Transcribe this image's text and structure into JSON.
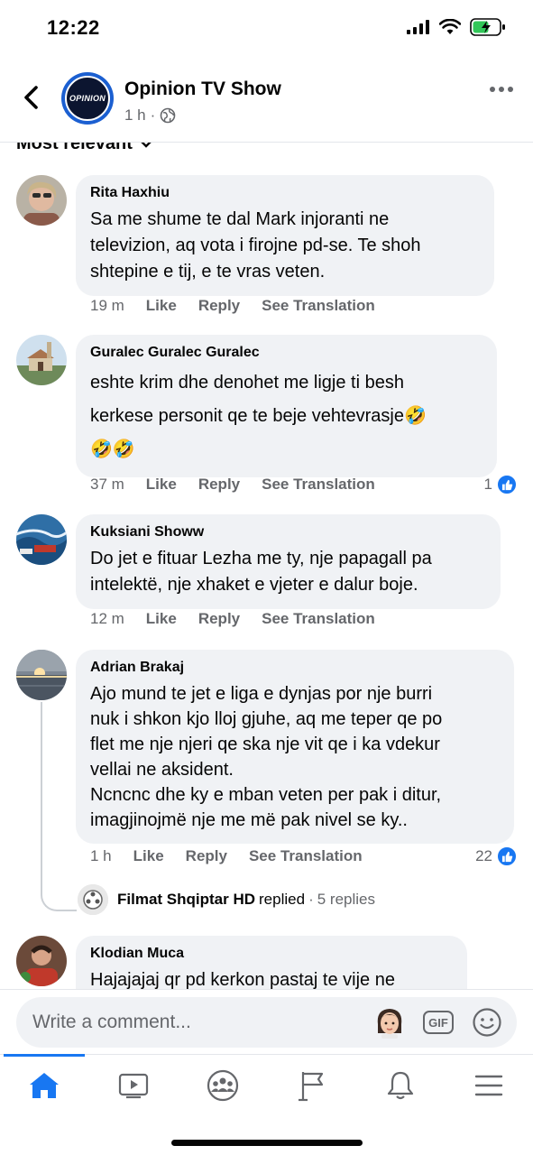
{
  "status": {
    "time": "12:22"
  },
  "header": {
    "page_name": "Opinion TV Show",
    "meta_time": "1 h",
    "meta_sep": "·",
    "logo_text": "OPINION"
  },
  "sort": {
    "label": "Most relevant"
  },
  "comments": [
    {
      "author": "Rita Haxhiu",
      "text": "Sa me shume te dal Mark injoranti ne\ntelevizion, aq vota i firojne pd-se. Te shoh\nshtepine e tij, e te vras veten.",
      "time": "19 m",
      "like": "Like",
      "reply": "Reply",
      "translate": "See Translation"
    },
    {
      "author": "Guralec Guralec Guralec",
      "text": "eshte krim dhe denohet me ligje ti besh\nkerkese personit qe te beje vehtevrasje🤣\n🤣🤣",
      "time": "37 m",
      "like": "Like",
      "reply": "Reply",
      "translate": "See Translation",
      "likes": "1"
    },
    {
      "author": "Kuksiani Showw",
      "text": "Do jet e fituar Lezha me ty, nje papagall pa\nintelektë, nje xhaket e vjeter e dalur boje.",
      "time": "12 m",
      "like": "Like",
      "reply": "Reply",
      "translate": "See Translation"
    },
    {
      "author": "Adrian Brakaj",
      "text": "Ajo mund te jet e liga e dynjas por nje burri\nnuk i shkon kjo lloj gjuhe, aq me teper qe po\nflet me nje njeri qe ska nje vit qe i ka vdekur\nvellai ne aksident.\nNcncnc dhe ky e mban veten per pak i ditur,\nimagjinojmë nje me më pak nivel se ky..",
      "time": "1 h",
      "like": "Like",
      "reply": "Reply",
      "translate": "See Translation",
      "likes": "22"
    },
    {
      "author": "Klodian Muca",
      "text": "Hajajajaj qr pd  kerkon pastaj  te vije ne"
    }
  ],
  "replies": {
    "name": "Filmat Shqiptar HD",
    "verb": "replied",
    "sep": "·",
    "count": "5 replies"
  },
  "composer": {
    "placeholder": "Write a comment...",
    "gif_label": "GIF"
  },
  "tabs": [
    "home-icon",
    "video-icon",
    "groups-icon",
    "pages-flag-icon",
    "notifications-bell-icon",
    "menu-icon"
  ],
  "colors": {
    "accent": "#1877f2",
    "bubble": "#f0f2f5",
    "secondary_text": "#65676b"
  }
}
